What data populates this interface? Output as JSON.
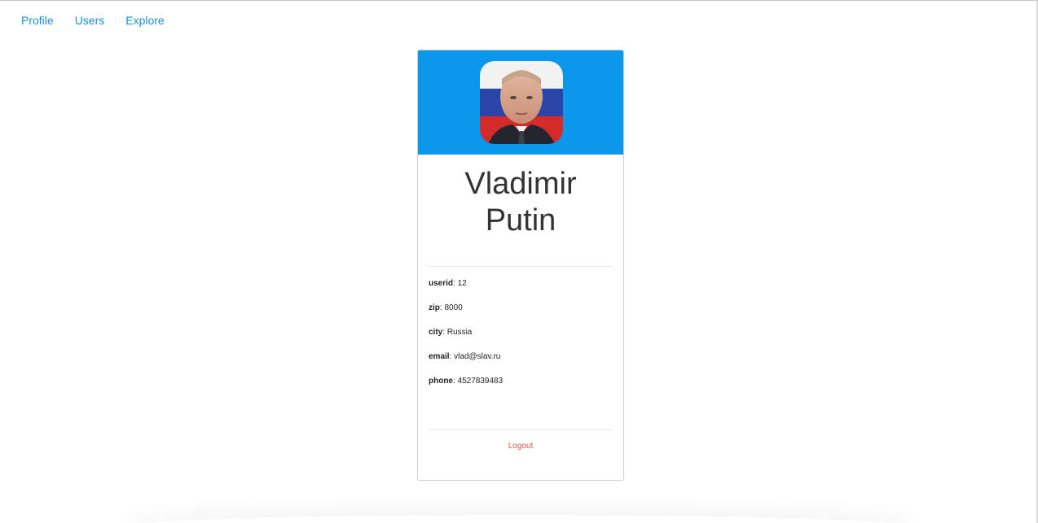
{
  "nav": {
    "items": [
      {
        "label": "Profile"
      },
      {
        "label": "Users"
      },
      {
        "label": "Explore"
      }
    ]
  },
  "profile": {
    "name_line1": "Vladimir",
    "name_line2": "Putin",
    "fields": [
      {
        "key": "userid",
        "value": ": 12"
      },
      {
        "key": "zip",
        "value": ": 8000"
      },
      {
        "key": "city",
        "value": ": Russia"
      },
      {
        "key": "email",
        "value": ": vlad@slav.ru"
      },
      {
        "key": "phone",
        "value": ": 4527839483"
      }
    ],
    "logout_label": "Logout"
  },
  "colors": {
    "header_bg": "#0a97ec",
    "link": "#1a8fd8",
    "logout": "#e0524c"
  }
}
